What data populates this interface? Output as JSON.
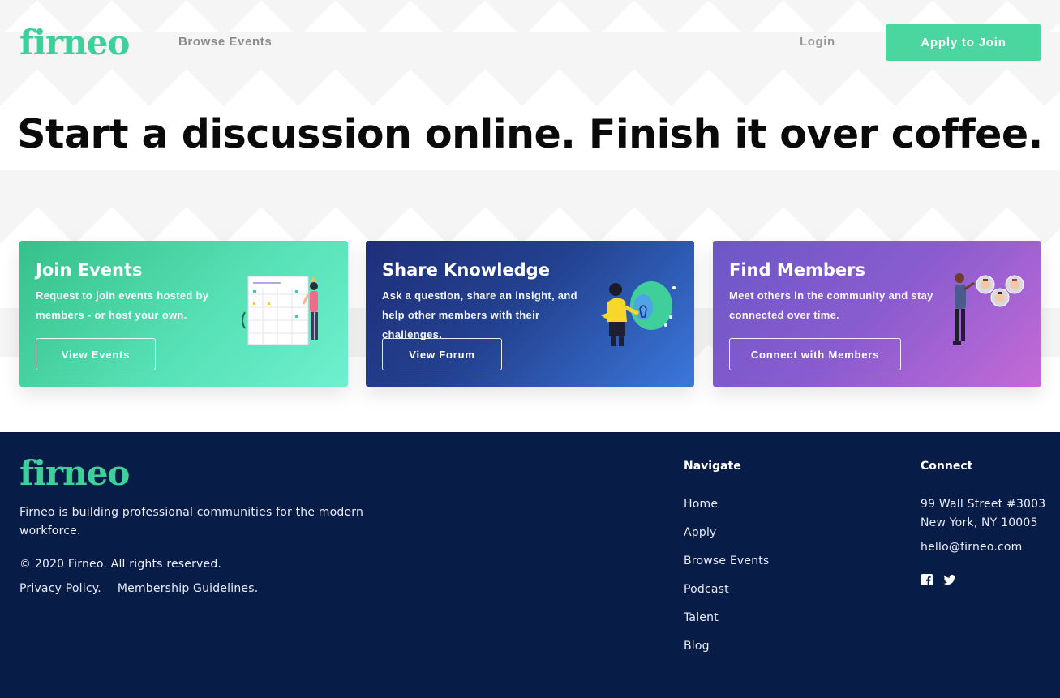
{
  "brand": {
    "logo_text": "firneo",
    "accent": "#4bd69f",
    "footer_bg": "#081c48"
  },
  "header": {
    "browse_events": "Browse Events",
    "login": "Login",
    "apply_button": "Apply to Join"
  },
  "hero": {
    "title": "Start a discussion online. Finish it over coffee."
  },
  "cards": [
    {
      "title": "Join Events",
      "description": "Request to join events hosted by members - or host your own.",
      "button": "View Events",
      "illustration": "calendar-illustration"
    },
    {
      "title": "Share Knowledge",
      "description": "Ask a question, share an insight, and help other members with their challenges.",
      "button": "View Forum",
      "illustration": "lightbulb-illustration"
    },
    {
      "title": "Find Members",
      "description": "Meet others in the community and stay connected over time.",
      "button": "Connect with Members",
      "illustration": "network-illustration"
    }
  ],
  "footer": {
    "logo_text": "firneo",
    "tagline": "Firneo is building professional communities for the modern workforce.",
    "copyright": "© 2020 Firneo. All rights reserved.",
    "privacy": "Privacy Policy.",
    "guidelines": "Membership Guidelines.",
    "navigate": {
      "heading": "Navigate",
      "items": [
        "Home",
        "Apply",
        "Browse Events",
        "Podcast",
        "Talent",
        "Blog"
      ]
    },
    "connect": {
      "heading": "Connect",
      "address_line1": "99 Wall Street #3003",
      "address_line2": "New York, NY 10005",
      "email": "hello@firneo.com",
      "social_icons": [
        "facebook-icon",
        "twitter-icon"
      ]
    }
  }
}
